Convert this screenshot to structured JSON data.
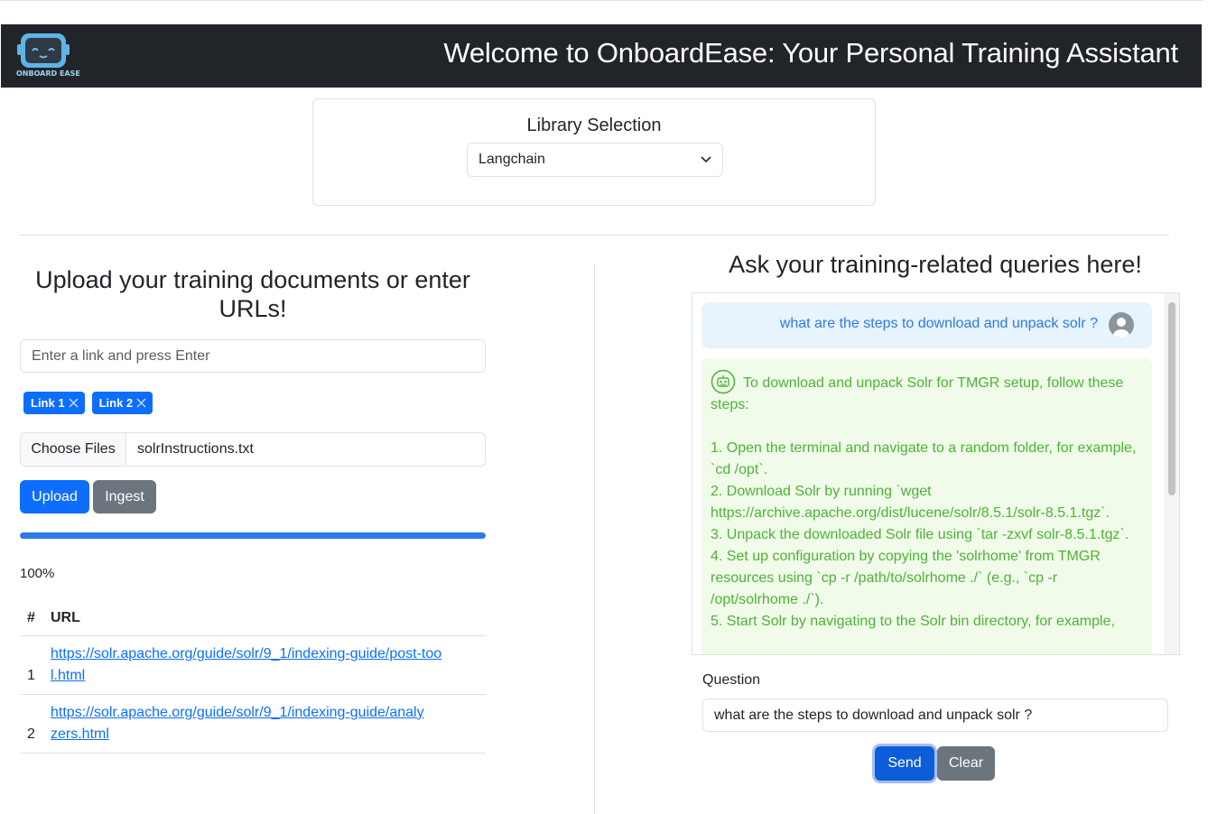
{
  "header": {
    "logo_text": "ONBOARD EASE",
    "title": "Welcome to OnboardEase: Your Personal Training Assistant"
  },
  "library": {
    "title": "Library Selection",
    "selected": "Langchain"
  },
  "upload": {
    "heading": "Upload your training documents or enter URLs!",
    "link_placeholder": "Enter a link and press Enter",
    "chips": [
      "Link 1",
      "Link 2"
    ],
    "choose_files_label": "Choose Files",
    "file_name": "solrInstructions.txt",
    "upload_label": "Upload",
    "ingest_label": "Ingest",
    "progress_percent": 100,
    "progress_text": "100%",
    "table": {
      "headers": [
        "#",
        "URL"
      ],
      "rows": [
        {
          "num": "1",
          "url": "https://solr.apache.org/guide/solr/9_1/indexing-guide/post-tool.html"
        },
        {
          "num": "2",
          "url": "https://solr.apache.org/guide/solr/9_1/indexing-guide/analyzers.html"
        }
      ]
    }
  },
  "chat": {
    "heading": "Ask your training-related queries here!",
    "user_message": "what are the steps to download and unpack solr ?",
    "bot_lines": [
      "To download and unpack Solr for TMGR setup, follow these steps:",
      "",
      "1. Open the terminal and navigate to a random folder, for example, `cd /opt`.",
      "2. Download Solr by running `wget https://archive.apache.org/dist/lucene/solr/8.5.1/solr-8.5.1.tgz`.",
      "3. Unpack the downloaded Solr file using `tar -zxvf solr-8.5.1.tgz`.",
      "4. Set up configuration by copying the 'solrhome' from TMGR resources using `cp -r /path/to/solrhome ./` (e.g., `cp -r /opt/solrhome ./`).",
      "5. Start Solr by navigating to the Solr bin directory, for example,"
    ],
    "question_label": "Question",
    "question_value": "what are the steps to download and unpack solr ?",
    "send_label": "Send",
    "clear_label": "Clear"
  },
  "colors": {
    "header_bg": "#212529",
    "primary": "#0d6efd",
    "secondary": "#6c757d",
    "bot_text": "#4fb238",
    "user_text": "#2c7be5"
  },
  "icons": {
    "logo": "robot-logo-icon",
    "chip_remove": "close-icon",
    "select_caret": "chevron-down-icon",
    "user_avatar": "user-avatar-icon",
    "bot_avatar": "robot-icon"
  }
}
